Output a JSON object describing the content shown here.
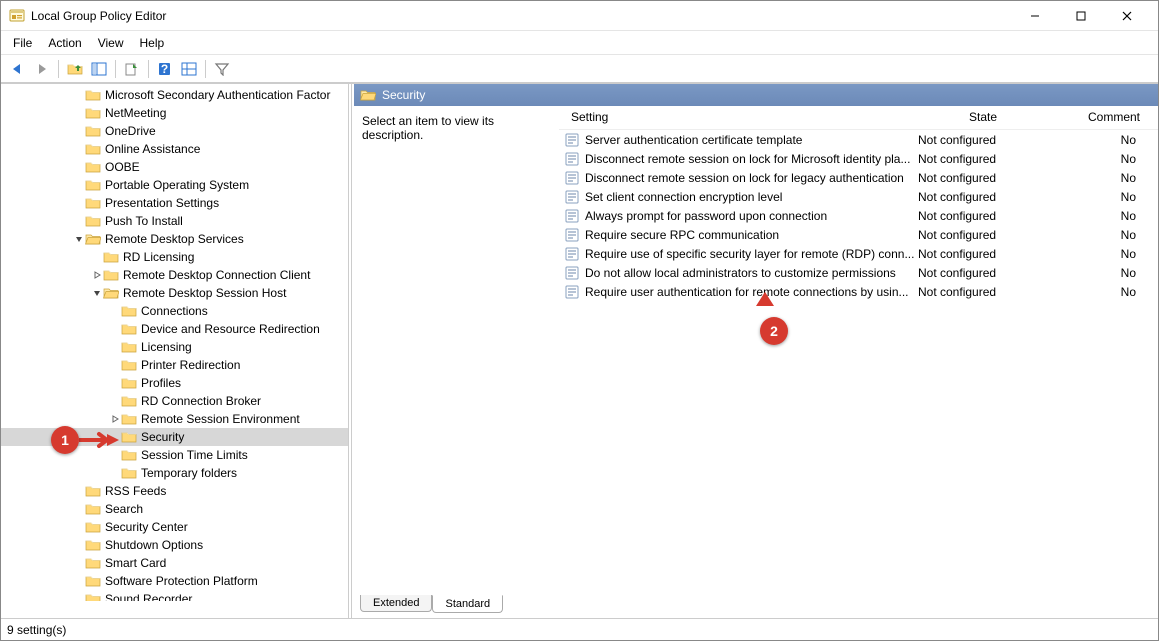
{
  "window": {
    "title": "Local Group Policy Editor"
  },
  "menu": [
    "File",
    "Action",
    "View",
    "Help"
  ],
  "tree_nodes": [
    {
      "l": 4,
      "t": "Microsoft Secondary Authentication Factor",
      "x": false
    },
    {
      "l": 4,
      "t": "NetMeeting",
      "x": false
    },
    {
      "l": 4,
      "t": "OneDrive",
      "x": false
    },
    {
      "l": 4,
      "t": "Online Assistance",
      "x": false
    },
    {
      "l": 4,
      "t": "OOBE",
      "x": false
    },
    {
      "l": 4,
      "t": "Portable Operating System",
      "x": false
    },
    {
      "l": 4,
      "t": "Presentation Settings",
      "x": false
    },
    {
      "l": 4,
      "t": "Push To Install",
      "x": false
    },
    {
      "l": 4,
      "t": "Remote Desktop Services",
      "x": "open"
    },
    {
      "l": 5,
      "t": "RD Licensing",
      "x": false
    },
    {
      "l": 5,
      "t": "Remote Desktop Connection Client",
      "x": "closed"
    },
    {
      "l": 5,
      "t": "Remote Desktop Session Host",
      "x": "open"
    },
    {
      "l": 6,
      "t": "Connections",
      "x": false
    },
    {
      "l": 6,
      "t": "Device and Resource Redirection",
      "x": false
    },
    {
      "l": 6,
      "t": "Licensing",
      "x": false
    },
    {
      "l": 6,
      "t": "Printer Redirection",
      "x": false
    },
    {
      "l": 6,
      "t": "Profiles",
      "x": false
    },
    {
      "l": 6,
      "t": "RD Connection Broker",
      "x": false
    },
    {
      "l": 6,
      "t": "Remote Session Environment",
      "x": "closed"
    },
    {
      "l": 6,
      "t": "Security",
      "x": false,
      "sel": true
    },
    {
      "l": 6,
      "t": "Session Time Limits",
      "x": false
    },
    {
      "l": 6,
      "t": "Temporary folders",
      "x": false
    },
    {
      "l": 4,
      "t": "RSS Feeds",
      "x": false
    },
    {
      "l": 4,
      "t": "Search",
      "x": false
    },
    {
      "l": 4,
      "t": "Security Center",
      "x": false
    },
    {
      "l": 4,
      "t": "Shutdown Options",
      "x": false
    },
    {
      "l": 4,
      "t": "Smart Card",
      "x": false
    },
    {
      "l": 4,
      "t": "Software Protection Platform",
      "x": false
    },
    {
      "l": 4,
      "t": "Sound Recorder",
      "x": false
    }
  ],
  "rpane": {
    "header": "Security",
    "desc": "Select an item to view its description.",
    "columns": {
      "c1": "Setting",
      "c2": "State",
      "c3": "Comment"
    },
    "rows": [
      {
        "s": "Server authentication certificate template",
        "st": "Not configured",
        "c": "No"
      },
      {
        "s": "Disconnect remote session on lock for Microsoft identity pla...",
        "st": "Not configured",
        "c": "No"
      },
      {
        "s": "Disconnect remote session on lock for legacy authentication",
        "st": "Not configured",
        "c": "No"
      },
      {
        "s": "Set client connection encryption level",
        "st": "Not configured",
        "c": "No"
      },
      {
        "s": "Always prompt for password upon connection",
        "st": "Not configured",
        "c": "No"
      },
      {
        "s": "Require secure RPC communication",
        "st": "Not configured",
        "c": "No"
      },
      {
        "s": "Require use of specific security layer for remote (RDP) conn...",
        "st": "Not configured",
        "c": "No"
      },
      {
        "s": "Do not allow local administrators to customize permissions",
        "st": "Not configured",
        "c": "No"
      },
      {
        "s": "Require user authentication for remote connections by usin...",
        "st": "Not configured",
        "c": "No"
      }
    ]
  },
  "tabs": {
    "extended": "Extended",
    "standard": "Standard"
  },
  "status": "9 setting(s)",
  "badges": {
    "one": "1",
    "two": "2"
  }
}
